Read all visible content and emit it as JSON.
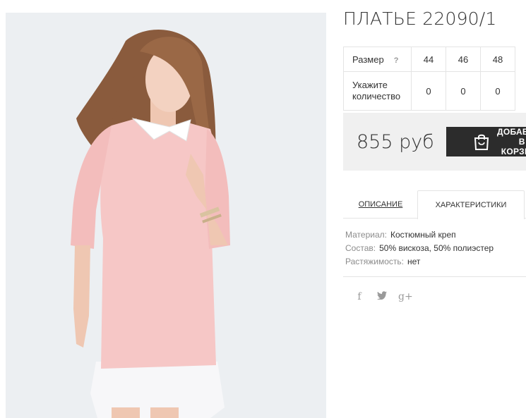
{
  "product": {
    "title": "ПЛАТЬЕ 22090/1",
    "price": "855 руб",
    "add_to_cart": "ДОБАВИТЬ В КОРЗИНУ"
  },
  "sizes": {
    "size_label": "Размер",
    "help": "?",
    "qty_label_line1": "Укажите",
    "qty_label_line2": "количество",
    "columns": [
      {
        "size": "44",
        "qty": "0"
      },
      {
        "size": "46",
        "qty": "0"
      },
      {
        "size": "48",
        "qty": "0"
      }
    ]
  },
  "tabs": {
    "description": "ОПИСАНИЕ",
    "characteristics": "ХАРАКТЕРИСТИКИ",
    "active": "characteristics"
  },
  "characteristics": [
    {
      "key": "Материал:",
      "value": "Костюмный креп"
    },
    {
      "key": "Состав:",
      "value": "50% вискоза, 50% полиэстер"
    },
    {
      "key": "Растяжимость:",
      "value": "нет"
    }
  ],
  "social": [
    {
      "icon": "facebook-icon",
      "glyph": "f"
    },
    {
      "icon": "twitter-icon",
      "glyph": "🐦"
    },
    {
      "icon": "google-plus-icon",
      "glyph": "g+"
    }
  ],
  "colors": {
    "dress": "#f6c7c6",
    "button": "#2c2c2c",
    "price_bg": "#f0f0f0",
    "photo_bg": "#eceff2"
  }
}
